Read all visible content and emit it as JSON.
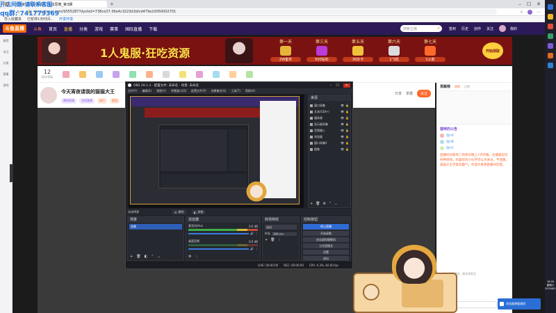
{
  "browser": {
    "tab_title": "今天宵夜请我的猫猫大王_迪思丽_第3期",
    "url": "www.douyu.com/9355287?dyshid=738ce37-36e4c3223d1bfcd479a10050002701",
    "bookmarks": [
      "导入收藏夹",
      "已暂停1天时间...",
      "开发环境"
    ],
    "watermark_line1": "开店问题-请联系客服",
    "watermark_line2": "qq群: 741779369"
  },
  "site": {
    "logo": "斗鱼直播",
    "nav": [
      "斗鱼",
      "首页",
      "直播",
      "分类",
      "游戏",
      "赛事",
      "国际直播",
      "下载"
    ],
    "search_placeholder": "搜索主播",
    "nav_right": [
      "签到",
      "历史",
      "创作",
      "关注",
      "我的"
    ],
    "left_rail": [
      "推荐",
      "关注",
      "分类",
      "赛事",
      "游戏"
    ],
    "banner_text": "1人鬼服·狂吃资源",
    "banner_days": [
      "第一天",
      "第三天",
      "第五天",
      "第六天",
      "第七天"
    ],
    "banner_rewards": [
      "2W金币",
      "500钻石",
      "30办卡",
      "1飞机",
      "1火箭"
    ],
    "banner_cta": "开始领取",
    "gift_level": "12",
    "gift_level_label": "粉丝等级",
    "room_title": "今天宵夜请我的猫猫大王",
    "room_tags": [
      "角色扮演",
      "主机游戏",
      "娱乐",
      "颜值"
    ],
    "room_actions": [
      "分享",
      "举报",
      "关注"
    ],
    "chat_header": "贡献榜",
    "chat_tabs": [
      "周榜",
      "日榜"
    ],
    "chat_announce_title": "猫咪的公告",
    "chat_body": "直播时间每周二到周日晚上7点开播，主播喜欢玩各种游戏，有喜欢的小伙伴可以点关注，不迷路。猫猫大王可爱又霸气，欢迎大家来直播间玩耍。",
    "chat_users": [
      "用户A",
      "用户B",
      "用户C"
    ],
    "chat_footer": "欢迎来到直播间，请文明发言",
    "chat_input_placeholder": "发个弹幕呗~",
    "chat_send": "发送"
  },
  "obs": {
    "title": "OBS 29.1.3 - 配置文件: 未命名 - 场景: 未命名",
    "menu": [
      "文件(F)",
      "编辑(E)",
      "视图(V)",
      "停靠窗口(D)",
      "配置文件(P)",
      "场景集合(S)",
      "工具(T)",
      "帮助(H)"
    ],
    "sources_title": "来源",
    "sources": [
      "窗口采集",
      "文本(GDI+)",
      "媒体源",
      "显示器采集",
      "音频输入",
      "浏览器",
      "窗口采集2",
      "图像"
    ],
    "preview_label": "未选择源",
    "props_button": "属性",
    "filters_button": "滤镜",
    "scenes_title": "场景",
    "scene_item": "场景",
    "mixer_title": "混音器",
    "mixer_tracks": [
      {
        "name": "麦克风/Aux",
        "db": "0.0 dB"
      },
      {
        "name": "桌面音频",
        "db": "0.0 dB"
      }
    ],
    "transition_title": "转场特效",
    "transition_type": "淡出",
    "duration_label": "时长",
    "duration_value": "300 ms",
    "controls_title": "控制按钮",
    "controls": [
      "停止直播",
      "开始录制",
      "启动虚拟摄像机",
      "工作室模式",
      "设置",
      "退出"
    ],
    "status_live": "LIVE: 00:00:00",
    "status_rec": "REC: 00:00:00",
    "status_cpu": "CPU: 0.3%, 60.00 fps"
  },
  "taskbar": {
    "time": "18:00",
    "day": "星期六",
    "date": "2025/6/13"
  },
  "notification": "浏览器弹窗通知",
  "colors": {
    "nav_bg": "#2b1a57",
    "banner_bg": "#7b1212",
    "accent": "#ff5d23",
    "obs_bg": "#1f2129",
    "obs_blue": "#2f6bd6"
  }
}
